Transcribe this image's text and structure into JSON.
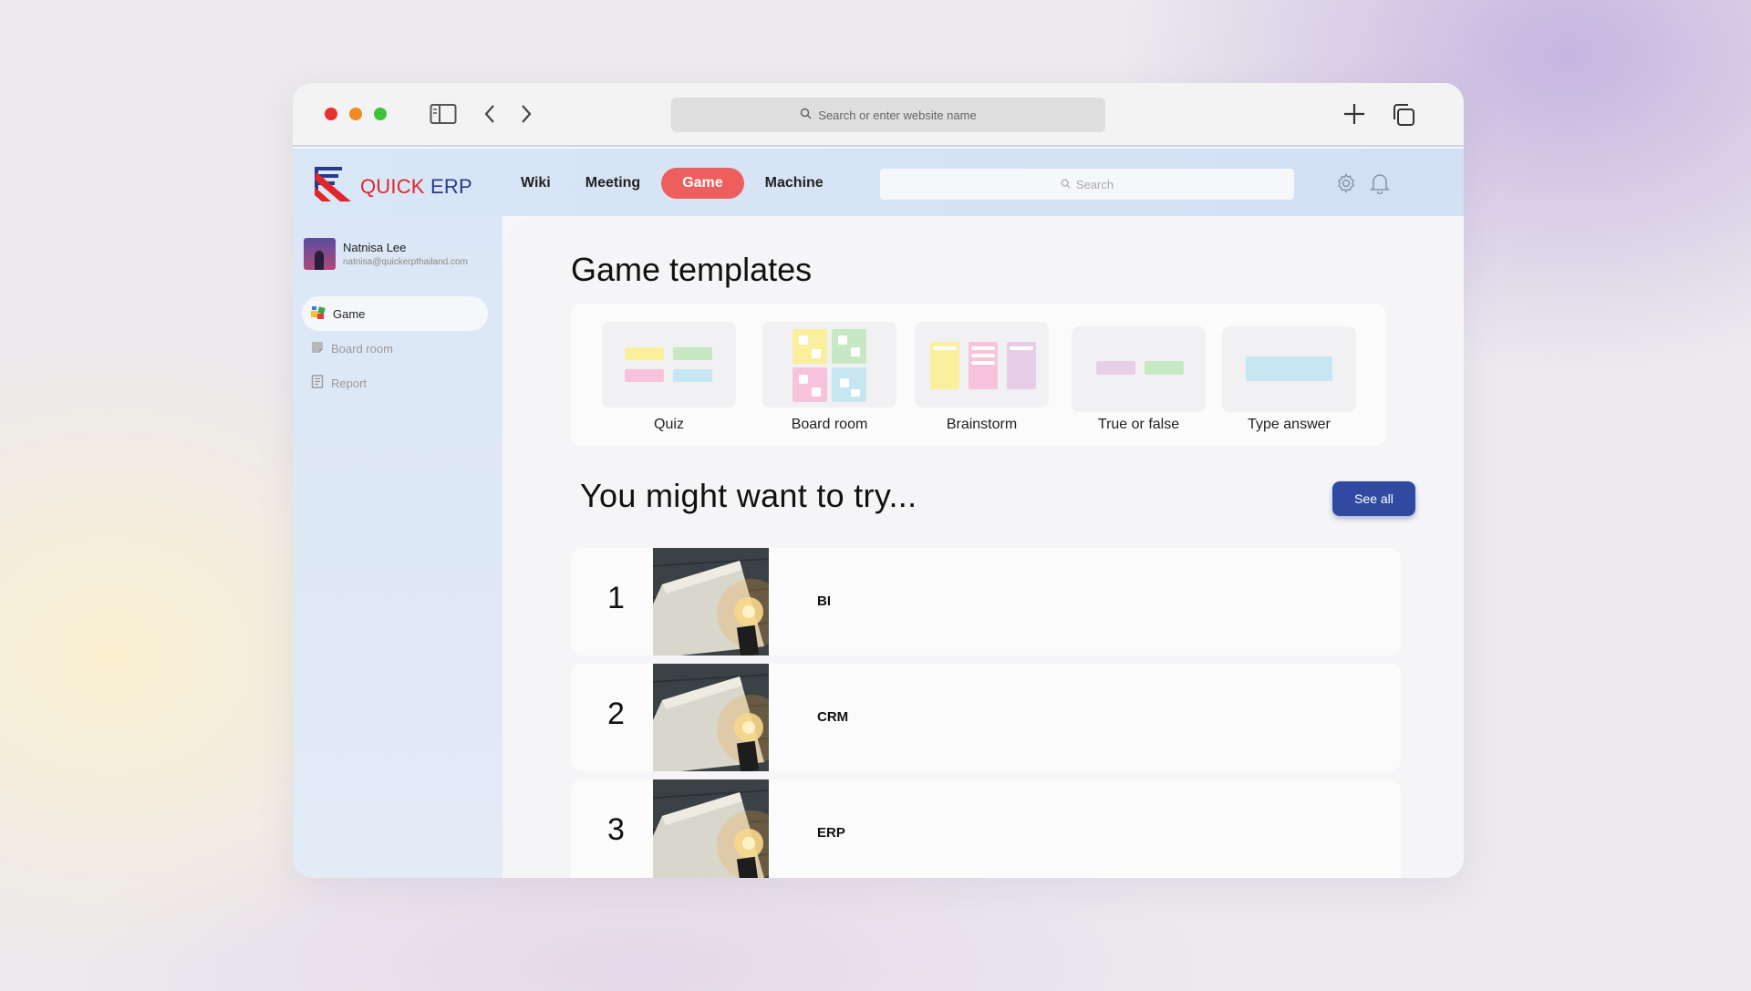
{
  "browser": {
    "url_placeholder": "Search or enter website name"
  },
  "app": {
    "logo_quick": "QUICK",
    "logo_erp": "ERP",
    "nav": [
      "Wiki",
      "Meeting",
      "Game",
      "Machine"
    ],
    "active_nav": "Game",
    "search_placeholder": "Search"
  },
  "user": {
    "name": "Natnisa Lee",
    "email": "natnisa@quickerpthailand.com"
  },
  "sidebar": {
    "items": [
      {
        "label": "Game",
        "icon": "game-icon",
        "active": true
      },
      {
        "label": "Board room",
        "icon": "board-room-icon",
        "active": false
      },
      {
        "label": "Report",
        "icon": "report-icon",
        "active": false
      }
    ]
  },
  "main": {
    "title": "Game templates",
    "templates": [
      "Quiz",
      "Board room",
      "Brainstorm",
      "True or false",
      "Type answer"
    ],
    "suggest_title": "You might want to try...",
    "see_all_label": "See all",
    "suggestions": [
      {
        "rank": "1",
        "title": "BI"
      },
      {
        "rank": "2",
        "title": "CRM"
      },
      {
        "rank": "3",
        "title": "ERP"
      }
    ]
  },
  "colors": {
    "accent_red": "#ed5f5c",
    "button_blue": "#2f4aa0",
    "logo_red": "#e0262a",
    "logo_navy": "#2a3a8a"
  }
}
